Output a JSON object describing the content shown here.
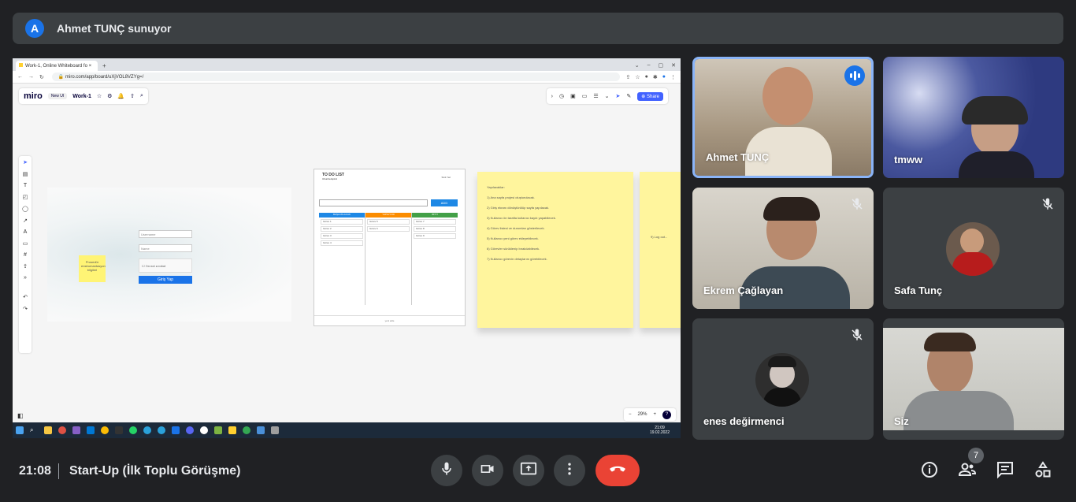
{
  "header": {
    "avatar_letter": "A",
    "presenting_text": "Ahmet TUNÇ sunuyor"
  },
  "shared_screen": {
    "browser": {
      "tab_title": "Work-1, Online Whiteboard fo",
      "new_tab": "+",
      "url": "miro.com/app/board/uXjVOL8VZYg=/"
    },
    "miro": {
      "logo": "miro",
      "badge": "New UI",
      "board_name": "Work-1",
      "share_label": "Share",
      "zoom_level": "29%",
      "login_frame": {
        "sticky_text": "Prosedür enstrumantasyon bilgileri",
        "username_placeholder": "Username",
        "password_placeholder": "Name",
        "captcha_label": "I'm not a robot",
        "login_button": "Giriş Yap"
      },
      "todo_frame": {
        "title": "TO DO LIST",
        "subtitle": "Ubunba Epirol",
        "top_right": "Sinit Yaz",
        "add_button": "ADD",
        "columns": [
          {
            "label": "BAŞLATILACAK",
            "color": "#1e88e5",
            "items": [
              "Görev 1",
              "Görev 2",
              "Görev 3",
              "Görev 4"
            ]
          },
          {
            "label": "YAPILIYOR",
            "color": "#fb8c00",
            "items": [
              "Görev 5",
              "Görev 6"
            ]
          },
          {
            "label": "BİTTİ",
            "color": "#43a047",
            "items": [
              "Görev 7",
              "Görev 8",
              "Görev 9"
            ]
          }
        ],
        "footer": "yeni ekle"
      },
      "sticky_note": {
        "heading": "Yapılacaklar:",
        "lines": [
          "1) Ana sayfa projesi oluşturulacak.",
          "2) Giriş ekranı dönüştürülüp sayfa yapılacak.",
          "3) Kullanıcı ön tarafta kullanıcı kaydı yapabilecek.",
          "4) Görev listesi ve durumları gösterilecek.",
          "5) Kullanıcı yeni görev ekleyebilecek.",
          "6) Görevler sürüklenip bırakılabilecek.",
          "7) Kullanıcı görevin detaylarını görebilecek."
        ]
      },
      "sticky_note_2": "9) Log out...",
      "taskbar_time": "21:09",
      "taskbar_date": "19.02.2022"
    }
  },
  "participants": [
    {
      "name": "Ahmet TUNÇ",
      "speaking": true,
      "muted": false
    },
    {
      "name": "tmww",
      "speaking": false,
      "muted": false
    },
    {
      "name": "Ekrem Çağlayan",
      "speaking": false,
      "muted": true
    },
    {
      "name": "Safa Tunç",
      "speaking": false,
      "muted": true
    },
    {
      "name": "enes değirmenci",
      "speaking": false,
      "muted": true
    },
    {
      "name": "Siz",
      "speaking": false,
      "muted": false
    }
  ],
  "bottom_bar": {
    "time": "21:08",
    "meeting_name": "Start-Up (İlk Toplu Görüşme)",
    "participant_count": "7"
  },
  "colors": {
    "background": "#202124",
    "tile": "#3c4043",
    "end_call": "#ea4335",
    "accent": "#1a73e8"
  }
}
